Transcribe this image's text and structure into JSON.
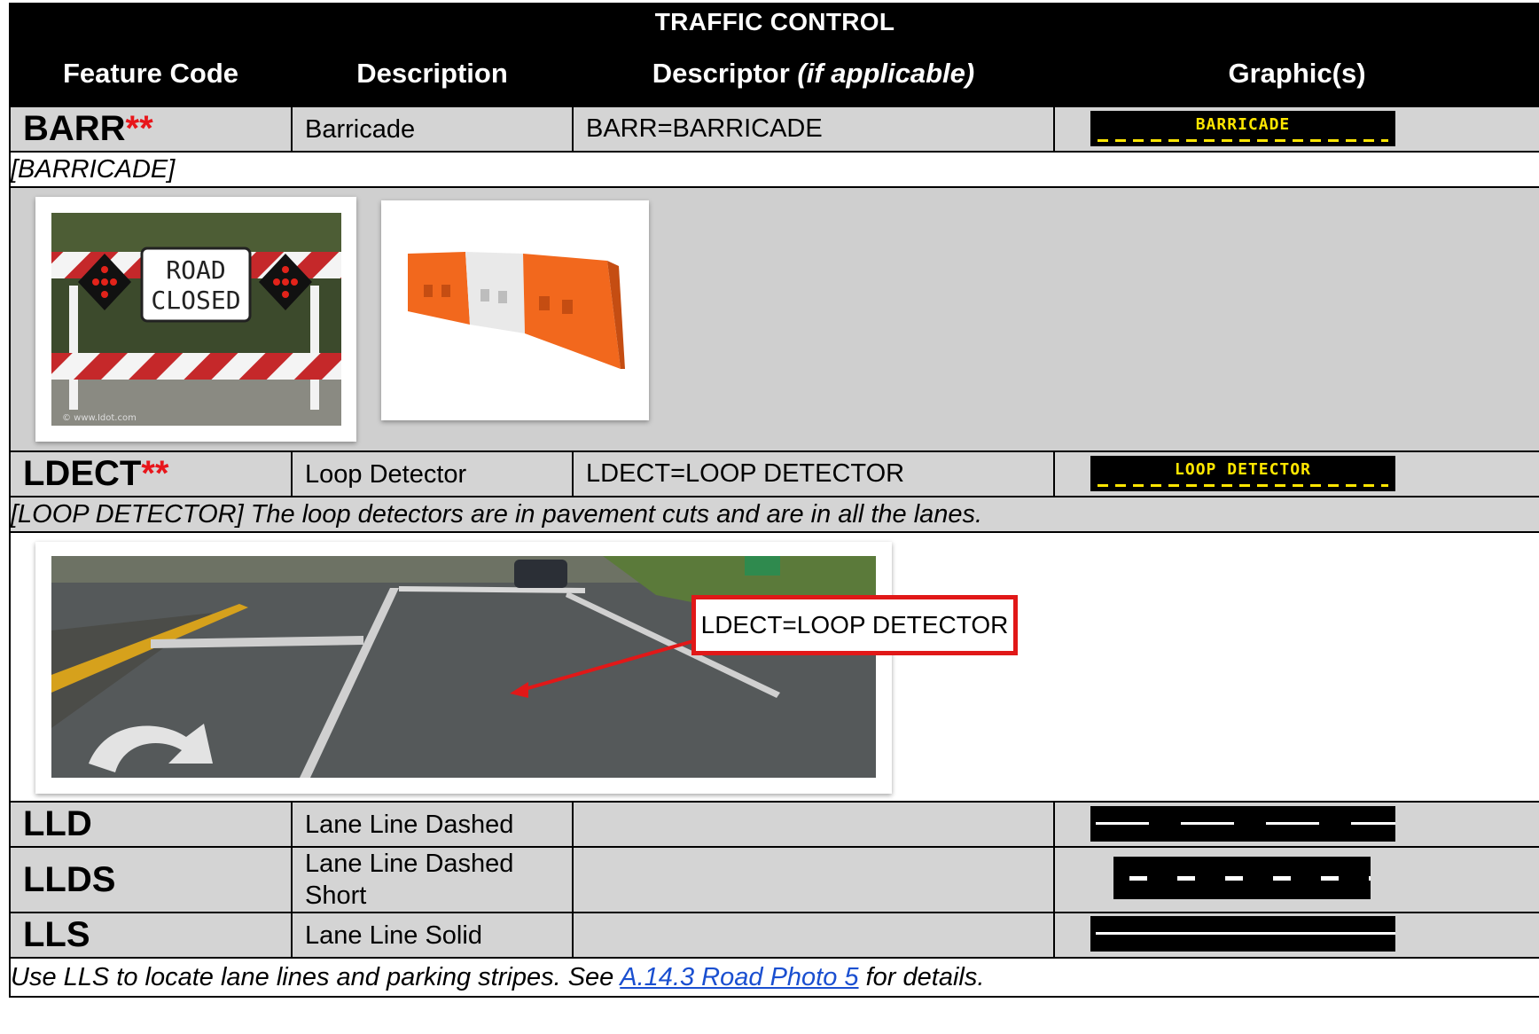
{
  "table": {
    "title": "TRAFFIC CONTROL",
    "headers": {
      "feature_code": "Feature Code",
      "description": "Description",
      "descriptor": "Descriptor",
      "descriptor_suffix": "(if applicable)",
      "graphics": "Graphic(s)"
    }
  },
  "rows": {
    "barr": {
      "code": "BARR",
      "marker": "**",
      "description": "Barricade",
      "descriptor": "BARR=BARRICADE",
      "graphic_text": "BARRICADE",
      "note": "[BARRICADE]",
      "photo1_sign": [
        "ROAD",
        "CLOSED"
      ],
      "photo1_watermark": "© www.Idot.com"
    },
    "ldect": {
      "code": "LDECT",
      "marker": "**",
      "description": "Loop Detector",
      "descriptor": "LDECT=LOOP DETECTOR",
      "graphic_text": "LOOP DETECTOR",
      "note": "[LOOP DETECTOR] The loop detectors are in pavement cuts and are in all the lanes.",
      "callout": "LDECT=LOOP DETECTOR"
    },
    "lld": {
      "code": "LLD",
      "description": "Lane Line Dashed",
      "descriptor": ""
    },
    "llds": {
      "code": "LLDS",
      "description": "Lane Line Dashed Short",
      "descriptor": ""
    },
    "lls": {
      "code": "LLS",
      "description": "Lane Line Solid",
      "descriptor": "",
      "note_prefix": "Use LLS to locate lane lines and parking stripes. See ",
      "note_link": "A.14.3 Road Photo 5",
      "note_suffix": " for details."
    }
  },
  "colors": {
    "header_bg": "#000000",
    "row_grey": "#d4d4d4",
    "asterisk_red": "#e8161b",
    "symbol_yellow": "#ffe600",
    "link_blue": "#1a4fd0",
    "callout_red": "#e11818"
  }
}
